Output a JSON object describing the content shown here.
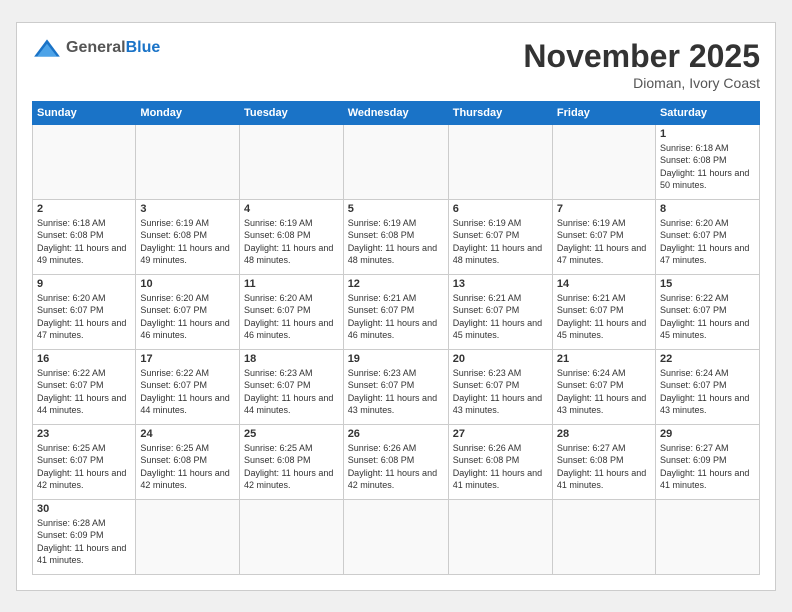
{
  "header": {
    "logo_general": "General",
    "logo_blue": "Blue",
    "month_title": "November 2025",
    "location": "Dioman, Ivory Coast"
  },
  "weekdays": [
    "Sunday",
    "Monday",
    "Tuesday",
    "Wednesday",
    "Thursday",
    "Friday",
    "Saturday"
  ],
  "weeks": [
    [
      {
        "day": "",
        "info": ""
      },
      {
        "day": "",
        "info": ""
      },
      {
        "day": "",
        "info": ""
      },
      {
        "day": "",
        "info": ""
      },
      {
        "day": "",
        "info": ""
      },
      {
        "day": "",
        "info": ""
      },
      {
        "day": "1",
        "info": "Sunrise: 6:18 AM\nSunset: 6:08 PM\nDaylight: 11 hours\nand 50 minutes."
      }
    ],
    [
      {
        "day": "2",
        "info": "Sunrise: 6:18 AM\nSunset: 6:08 PM\nDaylight: 11 hours\nand 49 minutes."
      },
      {
        "day": "3",
        "info": "Sunrise: 6:19 AM\nSunset: 6:08 PM\nDaylight: 11 hours\nand 49 minutes."
      },
      {
        "day": "4",
        "info": "Sunrise: 6:19 AM\nSunset: 6:08 PM\nDaylight: 11 hours\nand 48 minutes."
      },
      {
        "day": "5",
        "info": "Sunrise: 6:19 AM\nSunset: 6:08 PM\nDaylight: 11 hours\nand 48 minutes."
      },
      {
        "day": "6",
        "info": "Sunrise: 6:19 AM\nSunset: 6:07 PM\nDaylight: 11 hours\nand 48 minutes."
      },
      {
        "day": "7",
        "info": "Sunrise: 6:19 AM\nSunset: 6:07 PM\nDaylight: 11 hours\nand 47 minutes."
      },
      {
        "day": "8",
        "info": "Sunrise: 6:20 AM\nSunset: 6:07 PM\nDaylight: 11 hours\nand 47 minutes."
      }
    ],
    [
      {
        "day": "9",
        "info": "Sunrise: 6:20 AM\nSunset: 6:07 PM\nDaylight: 11 hours\nand 47 minutes."
      },
      {
        "day": "10",
        "info": "Sunrise: 6:20 AM\nSunset: 6:07 PM\nDaylight: 11 hours\nand 46 minutes."
      },
      {
        "day": "11",
        "info": "Sunrise: 6:20 AM\nSunset: 6:07 PM\nDaylight: 11 hours\nand 46 minutes."
      },
      {
        "day": "12",
        "info": "Sunrise: 6:21 AM\nSunset: 6:07 PM\nDaylight: 11 hours\nand 46 minutes."
      },
      {
        "day": "13",
        "info": "Sunrise: 6:21 AM\nSunset: 6:07 PM\nDaylight: 11 hours\nand 45 minutes."
      },
      {
        "day": "14",
        "info": "Sunrise: 6:21 AM\nSunset: 6:07 PM\nDaylight: 11 hours\nand 45 minutes."
      },
      {
        "day": "15",
        "info": "Sunrise: 6:22 AM\nSunset: 6:07 PM\nDaylight: 11 hours\nand 45 minutes."
      }
    ],
    [
      {
        "day": "16",
        "info": "Sunrise: 6:22 AM\nSunset: 6:07 PM\nDaylight: 11 hours\nand 44 minutes."
      },
      {
        "day": "17",
        "info": "Sunrise: 6:22 AM\nSunset: 6:07 PM\nDaylight: 11 hours\nand 44 minutes."
      },
      {
        "day": "18",
        "info": "Sunrise: 6:23 AM\nSunset: 6:07 PM\nDaylight: 11 hours\nand 44 minutes."
      },
      {
        "day": "19",
        "info": "Sunrise: 6:23 AM\nSunset: 6:07 PM\nDaylight: 11 hours\nand 43 minutes."
      },
      {
        "day": "20",
        "info": "Sunrise: 6:23 AM\nSunset: 6:07 PM\nDaylight: 11 hours\nand 43 minutes."
      },
      {
        "day": "21",
        "info": "Sunrise: 6:24 AM\nSunset: 6:07 PM\nDaylight: 11 hours\nand 43 minutes."
      },
      {
        "day": "22",
        "info": "Sunrise: 6:24 AM\nSunset: 6:07 PM\nDaylight: 11 hours\nand 43 minutes."
      }
    ],
    [
      {
        "day": "23",
        "info": "Sunrise: 6:25 AM\nSunset: 6:07 PM\nDaylight: 11 hours\nand 42 minutes."
      },
      {
        "day": "24",
        "info": "Sunrise: 6:25 AM\nSunset: 6:08 PM\nDaylight: 11 hours\nand 42 minutes."
      },
      {
        "day": "25",
        "info": "Sunrise: 6:25 AM\nSunset: 6:08 PM\nDaylight: 11 hours\nand 42 minutes."
      },
      {
        "day": "26",
        "info": "Sunrise: 6:26 AM\nSunset: 6:08 PM\nDaylight: 11 hours\nand 42 minutes."
      },
      {
        "day": "27",
        "info": "Sunrise: 6:26 AM\nSunset: 6:08 PM\nDaylight: 11 hours\nand 41 minutes."
      },
      {
        "day": "28",
        "info": "Sunrise: 6:27 AM\nSunset: 6:08 PM\nDaylight: 11 hours\nand 41 minutes."
      },
      {
        "day": "29",
        "info": "Sunrise: 6:27 AM\nSunset: 6:09 PM\nDaylight: 11 hours\nand 41 minutes."
      }
    ],
    [
      {
        "day": "30",
        "info": "Sunrise: 6:28 AM\nSunset: 6:09 PM\nDaylight: 11 hours\nand 41 minutes."
      },
      {
        "day": "",
        "info": ""
      },
      {
        "day": "",
        "info": ""
      },
      {
        "day": "",
        "info": ""
      },
      {
        "day": "",
        "info": ""
      },
      {
        "day": "",
        "info": ""
      },
      {
        "day": "",
        "info": ""
      }
    ]
  ]
}
